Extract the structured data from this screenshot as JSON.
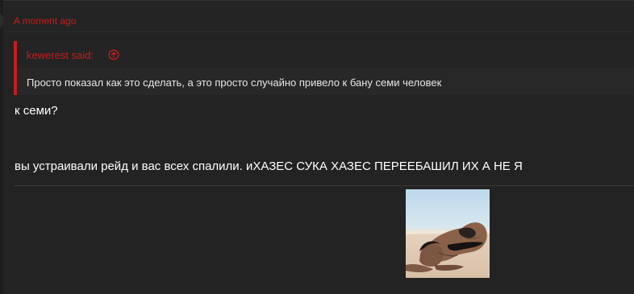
{
  "post": {
    "timestamp": "A moment ago",
    "quote": {
      "author": "kewerest said:",
      "jump_icon": "arrow-up-circle-icon",
      "text": "Просто показал как это сделать, а это просто случайно привело к бану семи человек"
    },
    "message_lines": [
      "к семи?",
      "вы устраивали рейд и вас всех спалили. иХАЗЕС СУКА ХАЗЕС ПЕРЕЕБАШИЛ ИХ А НЕ Я"
    ],
    "attachment": {
      "kind": "image-thumbnail"
    }
  },
  "colors": {
    "accent": "#c51d1d",
    "background": "#232323",
    "text": "#ffffff"
  }
}
